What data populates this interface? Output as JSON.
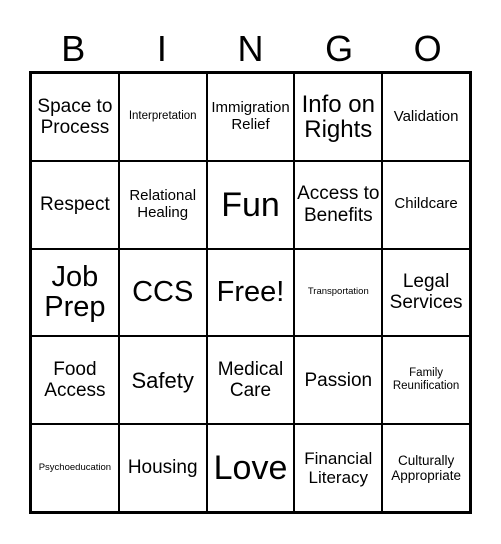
{
  "header": {
    "letters": [
      "B",
      "I",
      "N",
      "G",
      "O"
    ]
  },
  "grid": {
    "rows": [
      [
        "Space to Process",
        "Interpretation",
        "Immigration Relief",
        "Info on Rights",
        "Validation"
      ],
      [
        "Respect",
        "Relational Healing",
        "Fun",
        "Access to Benefits",
        "Childcare"
      ],
      [
        "Job Prep",
        "CCS",
        "Free!",
        "Transportation",
        "Legal Services"
      ],
      [
        "Food Access",
        "Safety",
        "Medical Care",
        "Passion",
        "Family Reunification"
      ],
      [
        "Psychoeducation",
        "Housing",
        "Love",
        "Financial Literacy",
        "Culturally Appropriate"
      ]
    ]
  }
}
